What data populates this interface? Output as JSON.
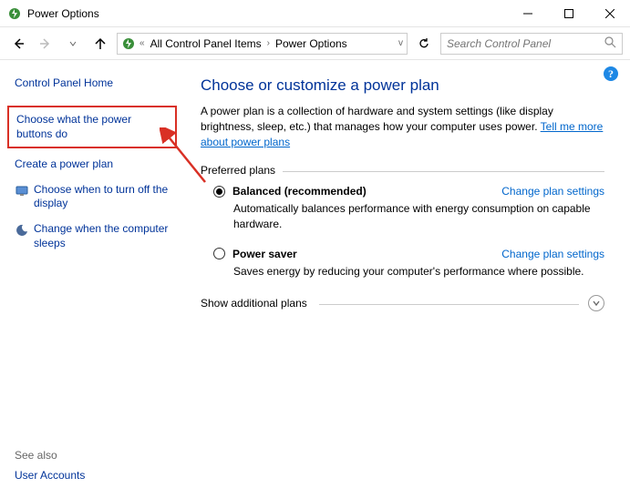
{
  "window": {
    "title": "Power Options"
  },
  "nav": {
    "breadcrumb": {
      "item1": "All Control Panel Items",
      "item2": "Power Options"
    },
    "search_placeholder": "Search Control Panel"
  },
  "sidebar": {
    "home": "Control Panel Home",
    "links": {
      "choose_buttons": "Choose what the power buttons do",
      "create_plan": "Create a power plan",
      "choose_off": "Choose when to turn off the display",
      "change_sleep": "Change when the computer sleeps"
    },
    "see_also": "See also",
    "user_accounts": "User Accounts"
  },
  "main": {
    "heading": "Choose or customize a power plan",
    "description_pre": "A power plan is a collection of hardware and system settings (like display brightness, sleep, etc.) that manages how your computer uses power. ",
    "description_link": "Tell me more about power plans",
    "preferred_label": "Preferred plans",
    "plans": {
      "balanced": {
        "name": "Balanced (recommended)",
        "desc": "Automatically balances performance with energy consumption on capable hardware.",
        "change": "Change plan settings"
      },
      "saver": {
        "name": "Power saver",
        "desc": "Saves energy by reducing your computer's performance where possible.",
        "change": "Change plan settings"
      }
    },
    "show_more": "Show additional plans"
  }
}
